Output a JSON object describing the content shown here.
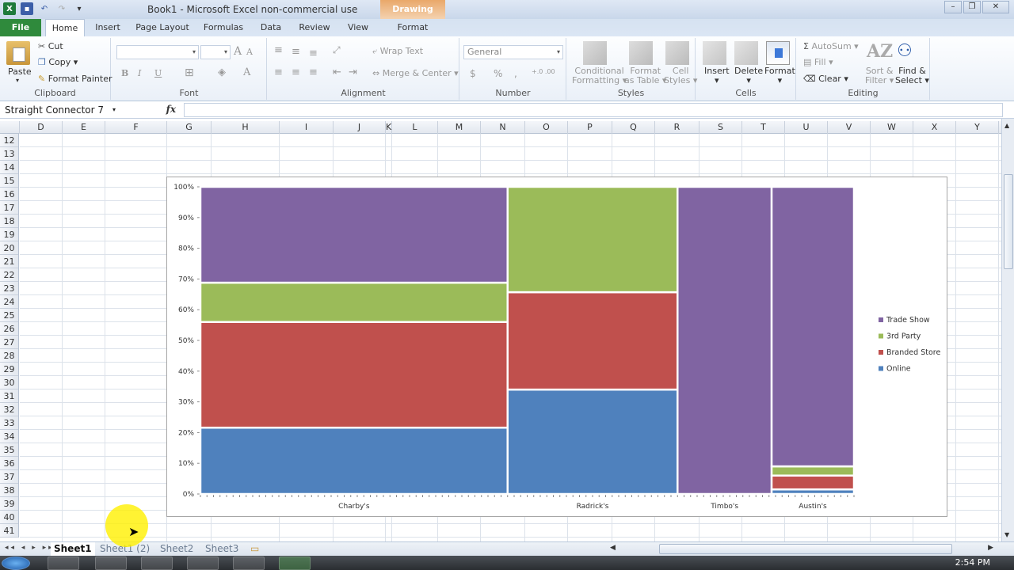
{
  "window": {
    "title": "Book1  -  Microsoft Excel non-commercial use",
    "contextual_tab_group": "Drawing Tools",
    "controls": [
      "minimize",
      "restore",
      "close"
    ]
  },
  "ribbon": {
    "tabs": [
      {
        "label": "File"
      },
      {
        "label": "Home",
        "active": true
      },
      {
        "label": "Insert"
      },
      {
        "label": "Page Layout"
      },
      {
        "label": "Formulas"
      },
      {
        "label": "Data"
      },
      {
        "label": "Review"
      },
      {
        "label": "View"
      },
      {
        "label": "Format"
      }
    ],
    "clipboard": {
      "label": "Clipboard",
      "paste": "Paste",
      "cut": "Cut",
      "copy": "Copy",
      "format_painter": "Format Painter"
    },
    "font": {
      "label": "Font",
      "bold": "B",
      "italic": "I",
      "underline": "U",
      "grow": "A",
      "shrink": "A"
    },
    "alignment": {
      "label": "Alignment",
      "wrap_text": "Wrap Text",
      "merge_center": "Merge & Center"
    },
    "number": {
      "label": "Number",
      "format": "General",
      "currency": "$",
      "percent": "%",
      "comma": ",",
      "inc_decimal": "+.0 .00",
      "dec_decimal": ".00 +.0"
    },
    "styles": {
      "label": "Styles",
      "conditional": [
        "Conditional",
        "Formatting"
      ],
      "format_table": [
        "Format",
        "as Table"
      ],
      "cell_styles": [
        "Cell",
        "Styles"
      ]
    },
    "cells": {
      "label": "Cells",
      "insert": "Insert",
      "delete": "Delete",
      "format": "Format"
    },
    "editing": {
      "label": "Editing",
      "autosum": "AutoSum",
      "fill": "Fill",
      "clear": "Clear",
      "sort_filter": [
        "Sort &",
        "Filter"
      ],
      "find_select": [
        "Find &",
        "Select"
      ]
    }
  },
  "formula_bar": {
    "name_box": "Straight Connector 7",
    "fx": "fx",
    "value": ""
  },
  "grid": {
    "columns": [
      "D",
      "E",
      "F",
      "G",
      "H",
      "I",
      "J",
      "K",
      "L",
      "M",
      "N",
      "O",
      "P",
      "Q",
      "R",
      "S",
      "T",
      "U",
      "V",
      "W",
      "X",
      "Y"
    ],
    "rows": [
      "12",
      "13",
      "14",
      "15",
      "16",
      "17",
      "18",
      "19",
      "20",
      "21",
      "22",
      "23",
      "24",
      "25",
      "26",
      "27",
      "28",
      "29",
      "30",
      "31",
      "32",
      "33",
      "34",
      "35",
      "36",
      "37",
      "38",
      "39",
      "40",
      "41"
    ]
  },
  "sheets": {
    "tabs": [
      {
        "label": "Sheet1",
        "active": true
      },
      {
        "label": "Sheet1 (2)"
      },
      {
        "label": "Sheet2"
      },
      {
        "label": "Sheet3"
      }
    ],
    "nav": "◂◂ ◂ ▸ ▸▸"
  },
  "taskbar": {
    "clock": "2:54 PM"
  },
  "colors": {
    "online": "#4f81bd",
    "branded_store": "#c0504d",
    "third_party": "#9bbb59",
    "trade_show": "#8064a2"
  },
  "chart_data": {
    "type": "bar",
    "subtype": "marimekko (variable-width 100% stacked)",
    "title": "",
    "xlabel": "",
    "ylabel": "",
    "ylim": [
      0,
      100
    ],
    "yticks": [
      "0%",
      "10%",
      "20%",
      "30%",
      "40%",
      "50%",
      "60%",
      "70%",
      "80%",
      "90%",
      "100%"
    ],
    "categories": [
      "Charby's",
      "Radrick's",
      "Timbo's",
      "Austin's"
    ],
    "widths_pct": [
      47,
      26,
      14.4,
      12.6
    ],
    "series": [
      {
        "name": "Online",
        "values": [
          21.6,
          34,
          0,
          1.5
        ]
      },
      {
        "name": "Branded Store",
        "values": [
          34.4,
          31.7,
          0,
          4.5
        ]
      },
      {
        "name": "3rd Party",
        "values": [
          12.8,
          34.3,
          0,
          3
        ]
      },
      {
        "name": "Trade Show",
        "values": [
          31.2,
          0,
          100,
          91
        ]
      }
    ],
    "legend": {
      "position": "right",
      "entries": [
        "Trade Show",
        "3rd Party",
        "Branded Store",
        "Online"
      ]
    },
    "grid": false
  }
}
